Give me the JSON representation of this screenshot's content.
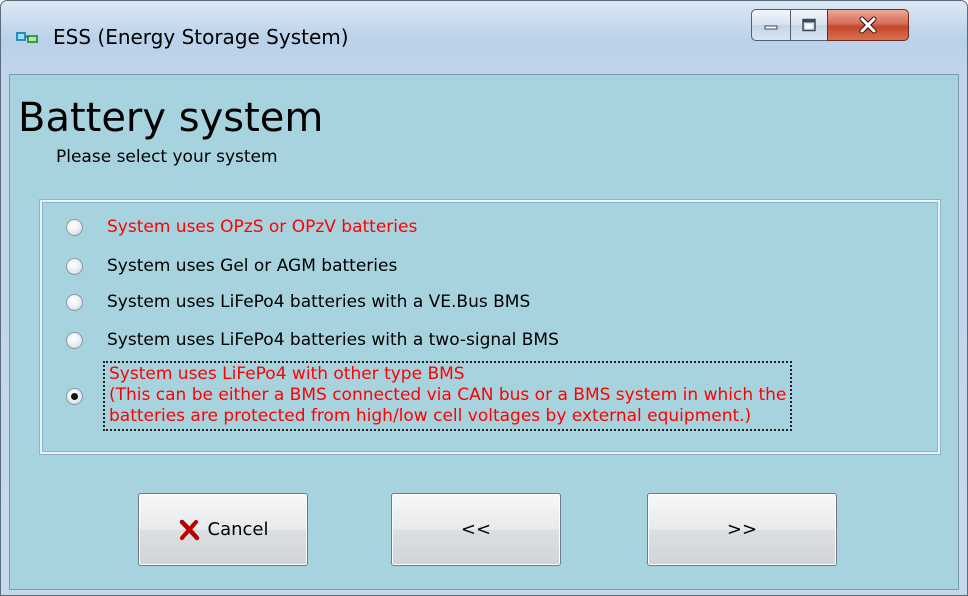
{
  "window": {
    "title": "ESS (Energy Storage System)",
    "icon": "ess-app-icon",
    "controls": [
      "minimize-icon",
      "maximize-icon",
      "close-icon"
    ]
  },
  "page": {
    "heading": "Battery system",
    "subheading": "Please select your system"
  },
  "options": [
    {
      "label": "System uses OPzS or OPzV batteries",
      "color": "#ff0000",
      "selected": false
    },
    {
      "label": "System uses Gel or AGM batteries",
      "color": "#000000",
      "selected": false
    },
    {
      "label": "System uses LiFePo4 batteries with a VE.Bus BMS",
      "color": "#000000",
      "selected": false
    },
    {
      "label": "System uses LiFePo4 batteries with a two-signal BMS",
      "color": "#000000",
      "selected": false
    },
    {
      "lines": [
        "System uses LiFePo4 with other type BMS",
        "(This can be either a BMS connected via CAN bus or a BMS system in which the",
        "batteries are protected from high/low cell voltages by external equipment.)"
      ],
      "color": "#ff0000",
      "selected": true
    }
  ],
  "buttons": {
    "cancel": {
      "label": "Cancel",
      "icon": "red-x-icon"
    },
    "back": {
      "label": "<<"
    },
    "next": {
      "label": ">>"
    }
  },
  "colors": {
    "client_background": "#a7d3df",
    "highlight_text": "#ff0000"
  }
}
